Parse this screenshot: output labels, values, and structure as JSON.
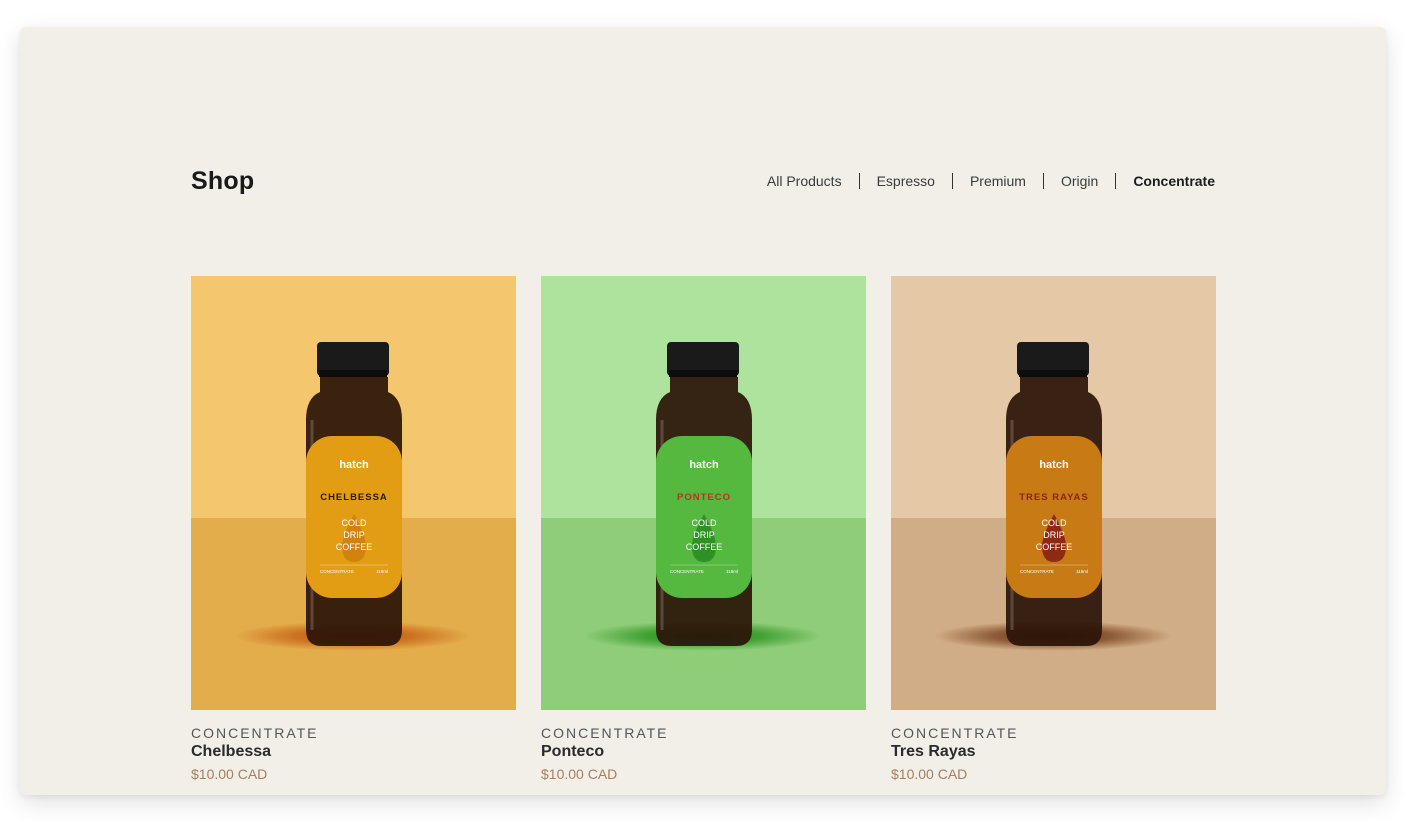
{
  "page": {
    "title": "Shop"
  },
  "filters": [
    {
      "label": "All Products",
      "active": false
    },
    {
      "label": "Espresso",
      "active": false
    },
    {
      "label": "Premium",
      "active": false
    },
    {
      "label": "Origin",
      "active": false
    },
    {
      "label": "Concentrate",
      "active": true
    }
  ],
  "products": [
    {
      "category": "CONCENTRATE",
      "name": "Chelbessa",
      "price": "$10.00 CAD",
      "label": {
        "brand": "hatch",
        "product": "CHELBESSA",
        "line1": "COLD",
        "line2": "DRIP",
        "line3": "COFFEE",
        "footer_left": "CONCENTRATE",
        "footer_right": "118ml"
      },
      "colors": {
        "wall": "#f4c66d",
        "floor": "#e4ad4b",
        "label": "#e29d14",
        "drop": "#d0840e",
        "product_text": "#2a1a05",
        "shadow": "#c0560c"
      }
    },
    {
      "category": "CONCENTRATE",
      "name": "Ponteco",
      "price": "$10.00 CAD",
      "label": {
        "brand": "hatch",
        "product": "PONTECO",
        "line1": "COLD",
        "line2": "DRIP",
        "line3": "COFFEE",
        "footer_left": "CONCENTRATE",
        "footer_right": "118ml"
      },
      "colors": {
        "wall": "#aee39d",
        "floor": "#8fcd79",
        "label": "#55b83f",
        "drop": "#2f9025",
        "product_text": "#c0311c",
        "shadow": "#1e8d14"
      }
    },
    {
      "category": "CONCENTRATE",
      "name": "Tres Rayas",
      "price": "$10.00 CAD",
      "label": {
        "brand": "hatch",
        "product": "TRES RAYAS",
        "line1": "COLD",
        "line2": "DRIP",
        "line3": "COFFEE",
        "footer_left": "CONCENTRATE",
        "footer_right": "118ml"
      },
      "colors": {
        "wall": "#e5c8a6",
        "floor": "#d1ad87",
        "label": "#c87a14",
        "drop": "#8e2a12",
        "product_text": "#8a2512",
        "shadow": "#6b3310"
      }
    }
  ]
}
